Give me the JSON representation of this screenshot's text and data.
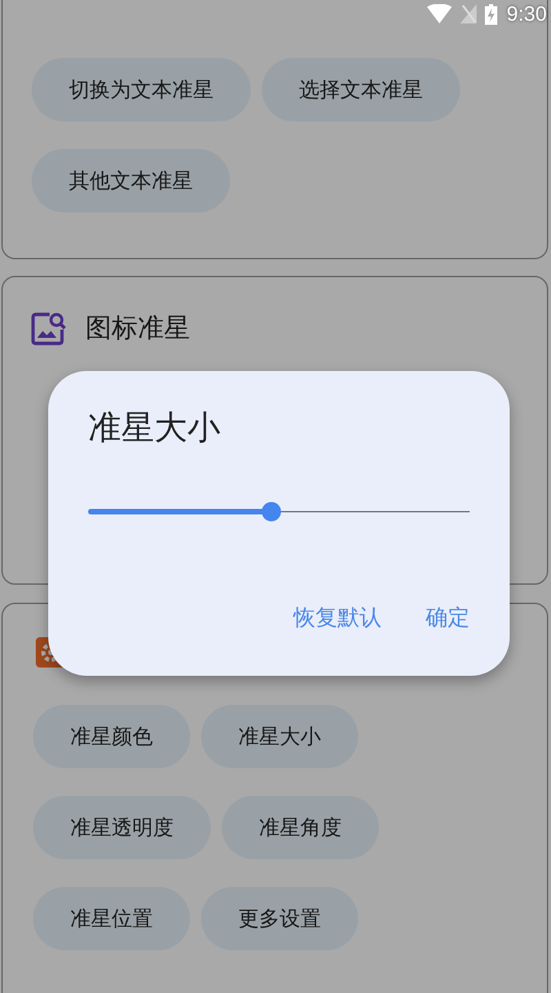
{
  "status_bar": {
    "time": "9:30"
  },
  "text_crosshair_card": {
    "buttons": [
      {
        "label": "切换为文本准星"
      },
      {
        "label": "选择文本准星"
      },
      {
        "label": "其他文本准星"
      }
    ]
  },
  "icon_crosshair_card": {
    "title": "图标准星"
  },
  "settings_card": {
    "buttons": [
      {
        "label": "准星颜色"
      },
      {
        "label": "准星大小"
      },
      {
        "label": "准星透明度"
      },
      {
        "label": "准星角度"
      },
      {
        "label": "准星位置"
      },
      {
        "label": "更多设置"
      }
    ]
  },
  "dialog": {
    "title": "准星大小",
    "slider": {
      "level": 0.48
    },
    "buttons": [
      {
        "label": "恢复默认"
      },
      {
        "label": "确定"
      }
    ]
  }
}
